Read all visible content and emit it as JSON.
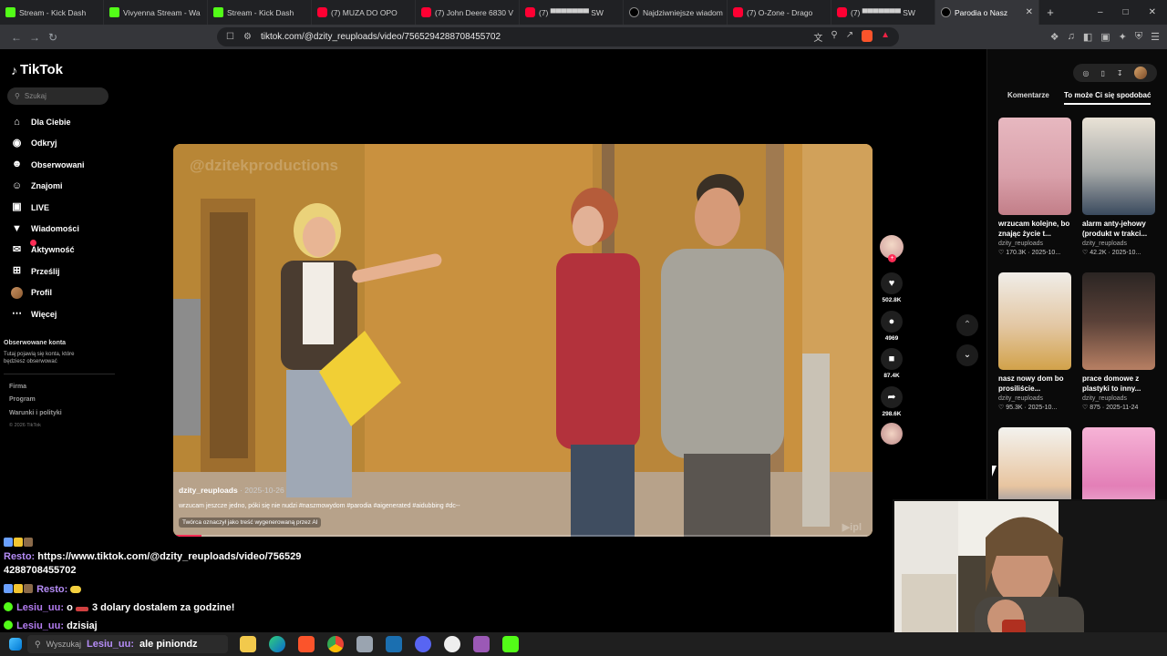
{
  "browser": {
    "tabs": [
      {
        "label": "Stream - Kick Dash",
        "icon": "kick",
        "active": false
      },
      {
        "label": "Vivyenna Stream - Wa",
        "icon": "kick",
        "active": false
      },
      {
        "label": "Stream - Kick Dash",
        "icon": "kick",
        "active": false
      },
      {
        "label": "(7) MUZA DO OPO",
        "icon": "youtube",
        "active": false
      },
      {
        "label": "(7) John Deere 6830 V",
        "icon": "youtube",
        "active": false
      },
      {
        "label": "(7) ▀▀▀▀▀▀▀ SW",
        "icon": "youtube",
        "active": false
      },
      {
        "label": "Najdziwniejsze wiadom",
        "icon": "tiktok",
        "active": false
      },
      {
        "label": "(7) O-Zone - Drago",
        "icon": "youtube",
        "active": false
      },
      {
        "label": "(7) ▀▀▀▀▀▀▀ SW",
        "icon": "youtube",
        "active": false
      },
      {
        "label": "Parodia o Nasz",
        "icon": "tiktok",
        "active": true
      }
    ],
    "url": "tiktok.com/@dzity_reuploads/video/7565294288708455702"
  },
  "tiktok": {
    "logo": "TikTok",
    "search_placeholder": "Szukaj",
    "nav": [
      {
        "label": "Dla Ciebie",
        "icon": "home-icon"
      },
      {
        "label": "Odkryj",
        "icon": "compass-icon"
      },
      {
        "label": "Obserwowani",
        "icon": "following-icon"
      },
      {
        "label": "Znajomi",
        "icon": "friends-icon"
      },
      {
        "label": "LIVE",
        "icon": "live-icon"
      },
      {
        "label": "Wiadomości",
        "icon": "messages-icon"
      },
      {
        "label": "Aktywność",
        "icon": "activity-icon"
      },
      {
        "label": "Prześlij",
        "icon": "upload-icon"
      },
      {
        "label": "Profil",
        "icon": "profile-avatar"
      },
      {
        "label": "Więcej",
        "icon": "more-icon"
      }
    ],
    "followed_heading": "Obserwowane konta",
    "followed_text": "Tutaj pojawią się konta, które będziesz obserwować",
    "footer": [
      "Firma",
      "Program",
      "Warunki i polityki"
    ],
    "copyright": "© 2026 TikTok"
  },
  "video": {
    "username": "dzity_reuploads",
    "date": "· 2025-10-26",
    "description": "wrzucam jeszcze jedno, póki się nie nudzi #naszmowydom #parodia #aigenerated #aidubbing #dc--",
    "ai_label": "Twórca oznaczył jako treść wygenerowaną przez AI",
    "watermark": "@dzitekproductions",
    "likes": "502.8K",
    "comments": "4969",
    "saves": "87.4K",
    "shares": "298.6K",
    "progress": 0.04
  },
  "right_panel": {
    "tabs": [
      "Komentarze",
      "To może Ci się spodobać"
    ],
    "cards": [
      {
        "title": "wrzucam kolejne, bo znając życie t...",
        "user": "dzity_reuploads",
        "meta": "♡ 170.3K · 2025-10..."
      },
      {
        "title": "alarm anty-jehowy (produkt w trakci...",
        "user": "dzity_reuploads",
        "meta": "♡ 42.2K · 2025-10..."
      },
      {
        "title": "nasz nowy dom bo prosiliście...",
        "user": "dzity_reuploads",
        "meta": "♡ 95.3K · 2025-10..."
      },
      {
        "title": "prace domowe z plastyki to inny...",
        "user": "dzity_reuploads",
        "meta": "♡ 875 · 2025-11-24"
      },
      {
        "title": "",
        "user": "",
        "meta": ""
      },
      {
        "title": "",
        "user": "",
        "meta": ""
      }
    ]
  },
  "chat": {
    "line1_name": "Resto:",
    "line1_text": "https://www.tiktok.com/@dzity_reuploads/video/756529",
    "line2_text": "4288708455702",
    "line3_name": "Resto:",
    "line4_name": "Lesiu_uu:",
    "line4_text": "o",
    "line4_text2": "3 dolary dostalem za godzine!",
    "line5_name": "Lesiu_uu:",
    "line5_text": "dzisiaj",
    "line6_name": "Lesiu_uu:",
    "line6_text": "ale piniondz"
  },
  "taskbar": {
    "search_placeholder": "Wyszukaj"
  },
  "colors": {
    "accent": "#fe2c55",
    "chat_name": "#b58cf6",
    "kick": "#53fc18"
  }
}
